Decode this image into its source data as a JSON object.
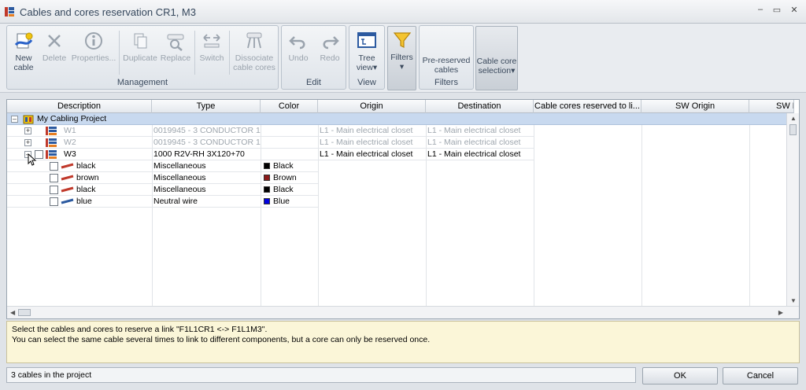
{
  "window": {
    "title": "Cables and cores reservation CR1, M3",
    "controls": [
      "–",
      "▭",
      "✕"
    ]
  },
  "ribbon": {
    "management": {
      "label": "Management",
      "new_cable": [
        "New",
        "cable"
      ],
      "delete": "Delete",
      "properties": "Properties...",
      "duplicate": "Duplicate",
      "replace": "Replace",
      "switch": "Switch",
      "dissociate": [
        "Dissociate",
        "cable cores"
      ]
    },
    "edit": {
      "label": "Edit",
      "undo": "Undo",
      "redo": "Redo"
    },
    "view": {
      "label": "View",
      "tree_view": [
        "Tree",
        "view"
      ]
    },
    "filters_button": "Filters",
    "filters": {
      "label": "Filters",
      "pre_reserved": [
        "Pre-reserved",
        "cables"
      ]
    },
    "cable_core_selection": [
      "Cable core",
      "selection"
    ]
  },
  "grid": {
    "columns": [
      "Description",
      "Type",
      "Color",
      "Origin",
      "Destination",
      "Cable cores reserved to li...",
      "SW Origin",
      "SW De"
    ],
    "project_row": "My Cabling Project",
    "cables": [
      {
        "expander": "+",
        "name": "W1",
        "type": "0019945 - 3 CONDUCTOR 1...",
        "origin": "L1 - Main electrical closet",
        "destination": "L1 - Main electrical closet",
        "dim": true
      },
      {
        "expander": "+",
        "name": "W2",
        "type": "0019945 - 3 CONDUCTOR 1...",
        "origin": "L1 - Main electrical closet",
        "destination": "L1 - Main electrical closet",
        "dim": true
      },
      {
        "expander": "–",
        "name": "W3",
        "type": "1000 R2V-RH 3X120+70",
        "origin": "L1 - Main electrical closet",
        "destination": "L1 - Main electrical closet",
        "dim": false
      }
    ],
    "cores": [
      {
        "name": "black",
        "type": "Miscellaneous",
        "color": "Black",
        "hex": "#000000"
      },
      {
        "name": "brown",
        "type": "Miscellaneous",
        "color": "Brown",
        "hex": "#8b1a1a"
      },
      {
        "name": "black",
        "type": "Miscellaneous",
        "color": "Black",
        "hex": "#000000"
      },
      {
        "name": "blue",
        "type": "Neutral wire",
        "color": "Blue",
        "hex": "#0000e0"
      }
    ]
  },
  "info": {
    "line1": "Select the cables and cores to reserve a link \"F1L1CR1 <-> F1L1M3\".",
    "line2": "You can select the same cable several times to link to different components, but a core can only be reserved once."
  },
  "status": "3 cables in the project",
  "buttons": {
    "ok": "OK",
    "cancel": "Cancel"
  },
  "colors": {
    "accent": "#c8d9ef",
    "info_bg": "#fbf6d8"
  }
}
